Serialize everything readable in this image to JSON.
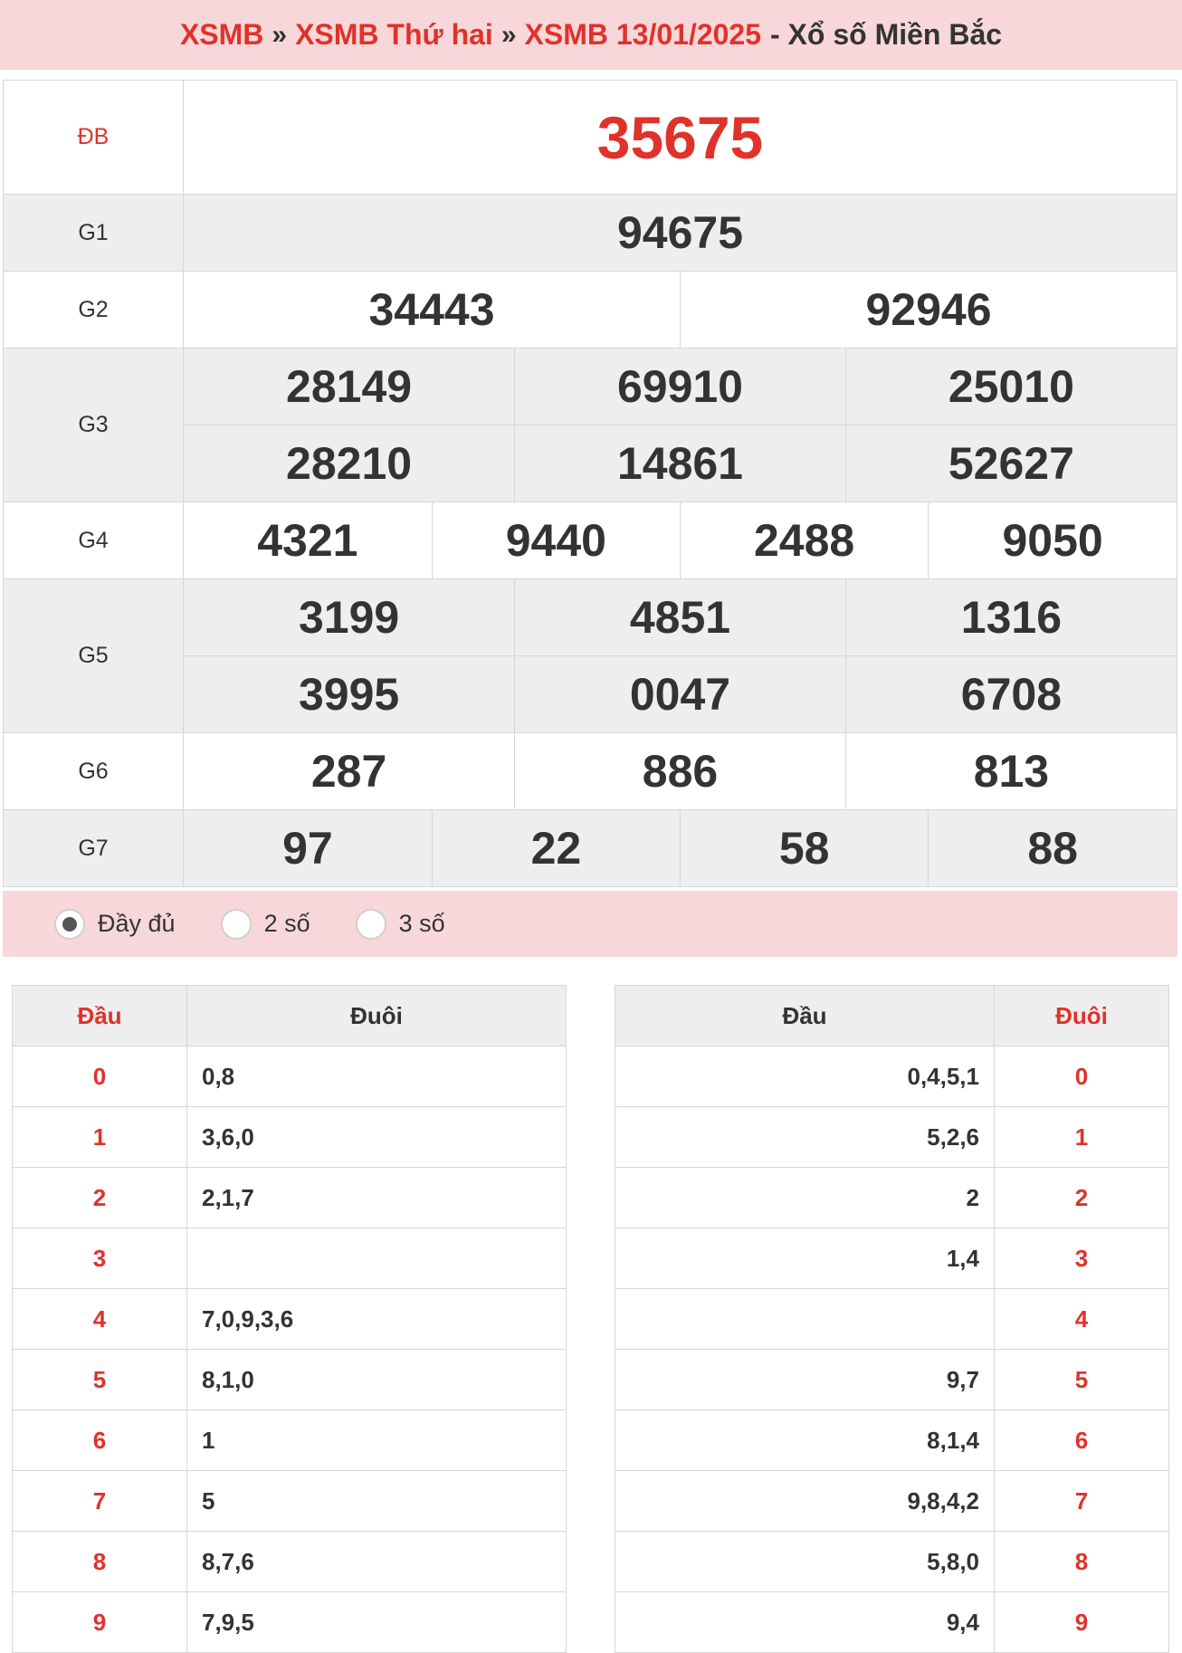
{
  "breadcrumb": {
    "items": [
      "XSMB",
      "XSMB Thứ hai",
      "XSMB 13/01/2025"
    ],
    "separator": "»",
    "suffix": "- Xổ số Miền Bắc"
  },
  "results": {
    "db": {
      "label": "ĐB",
      "numbers": [
        "35675"
      ]
    },
    "g1": {
      "label": "G1",
      "numbers": [
        "94675"
      ]
    },
    "g2": {
      "label": "G2",
      "numbers": [
        "34443",
        "92946"
      ]
    },
    "g3": {
      "label": "G3",
      "numbers": [
        "28149",
        "69910",
        "25010",
        "28210",
        "14861",
        "52627"
      ]
    },
    "g4": {
      "label": "G4",
      "numbers": [
        "4321",
        "9440",
        "2488",
        "9050"
      ]
    },
    "g5": {
      "label": "G5",
      "numbers": [
        "3199",
        "4851",
        "1316",
        "3995",
        "0047",
        "6708"
      ]
    },
    "g6": {
      "label": "G6",
      "numbers": [
        "287",
        "886",
        "813"
      ]
    },
    "g7": {
      "label": "G7",
      "numbers": [
        "97",
        "22",
        "58",
        "88"
      ]
    }
  },
  "options": {
    "selected": "full",
    "items": [
      {
        "key": "full",
        "label": "Đầy đủ"
      },
      {
        "key": "two",
        "label": "2 số"
      },
      {
        "key": "three",
        "label": "3 số"
      }
    ]
  },
  "loto_head": {
    "col_head": "Đầu",
    "col_tail": "Đuôi",
    "rows": [
      {
        "head": "0",
        "tail": "0,8"
      },
      {
        "head": "1",
        "tail": "3,6,0"
      },
      {
        "head": "2",
        "tail": "2,1,7"
      },
      {
        "head": "3",
        "tail": ""
      },
      {
        "head": "4",
        "tail": "7,0,9,3,6"
      },
      {
        "head": "5",
        "tail": "8,1,0"
      },
      {
        "head": "6",
        "tail": "1"
      },
      {
        "head": "7",
        "tail": "5"
      },
      {
        "head": "8",
        "tail": "8,7,6"
      },
      {
        "head": "9",
        "tail": "7,9,5"
      }
    ]
  },
  "loto_tail": {
    "col_head": "Đầu",
    "col_tail": "Đuôi",
    "rows": [
      {
        "head": "0,4,5,1",
        "tail": "0"
      },
      {
        "head": "5,2,6",
        "tail": "1"
      },
      {
        "head": "2",
        "tail": "2"
      },
      {
        "head": "1,4",
        "tail": "3"
      },
      {
        "head": "",
        "tail": "4"
      },
      {
        "head": "9,7",
        "tail": "5"
      },
      {
        "head": "8,1,4",
        "tail": "6"
      },
      {
        "head": "9,8,4,2",
        "tail": "7"
      },
      {
        "head": "5,8,0",
        "tail": "8"
      },
      {
        "head": "9,4",
        "tail": "9"
      }
    ]
  }
}
